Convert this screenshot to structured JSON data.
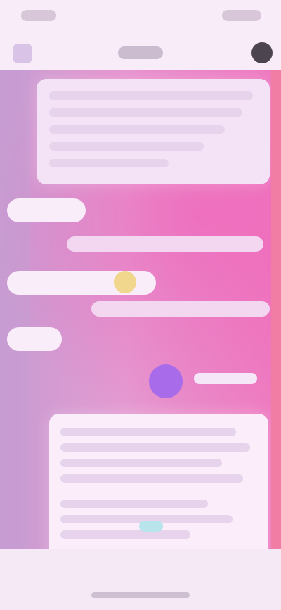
{
  "status_bar": {},
  "topbar": {},
  "chat": {
    "assistant": {}
  }
}
